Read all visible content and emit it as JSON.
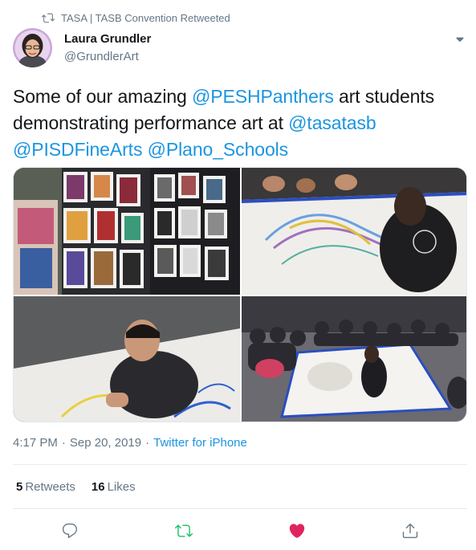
{
  "retweet_context": {
    "text": "TASA | TASB Convention Retweeted",
    "icon": "retweet-icon"
  },
  "author": {
    "name": "Laura Grundler",
    "handle": "@GrundlerArt",
    "avatar_icon": "profile-avatar"
  },
  "tweet": {
    "part1": "Some of our amazing ",
    "mention1": "@PESHPanthers",
    "part2": " art students demonstrating performance art at ",
    "mention2": "@tasatasb",
    "mention3": "@PISDFineArts",
    "mention4": "@Plano_Schools"
  },
  "media": {
    "count": 4,
    "items": [
      "art-display-wall-photo",
      "student-drawing-on-paper-photo",
      "student-kneeling-drawing-photo",
      "crowd-watching-performance-photo"
    ]
  },
  "meta": {
    "time": "4:17 PM",
    "separator": "·",
    "date": "Sep 20, 2019",
    "source": "Twitter for iPhone"
  },
  "stats": {
    "retweets_count": "5",
    "retweets_label": "Retweets",
    "likes_count": "16",
    "likes_label": "Likes"
  },
  "actions": [
    "reply-icon",
    "retweet-icon",
    "like-icon",
    "share-icon"
  ],
  "colors": {
    "link": "#1b95e0",
    "secondary": "#657786",
    "retweet_active": "#17bf63",
    "like_active": "#e0245e",
    "text": "#14171a"
  }
}
